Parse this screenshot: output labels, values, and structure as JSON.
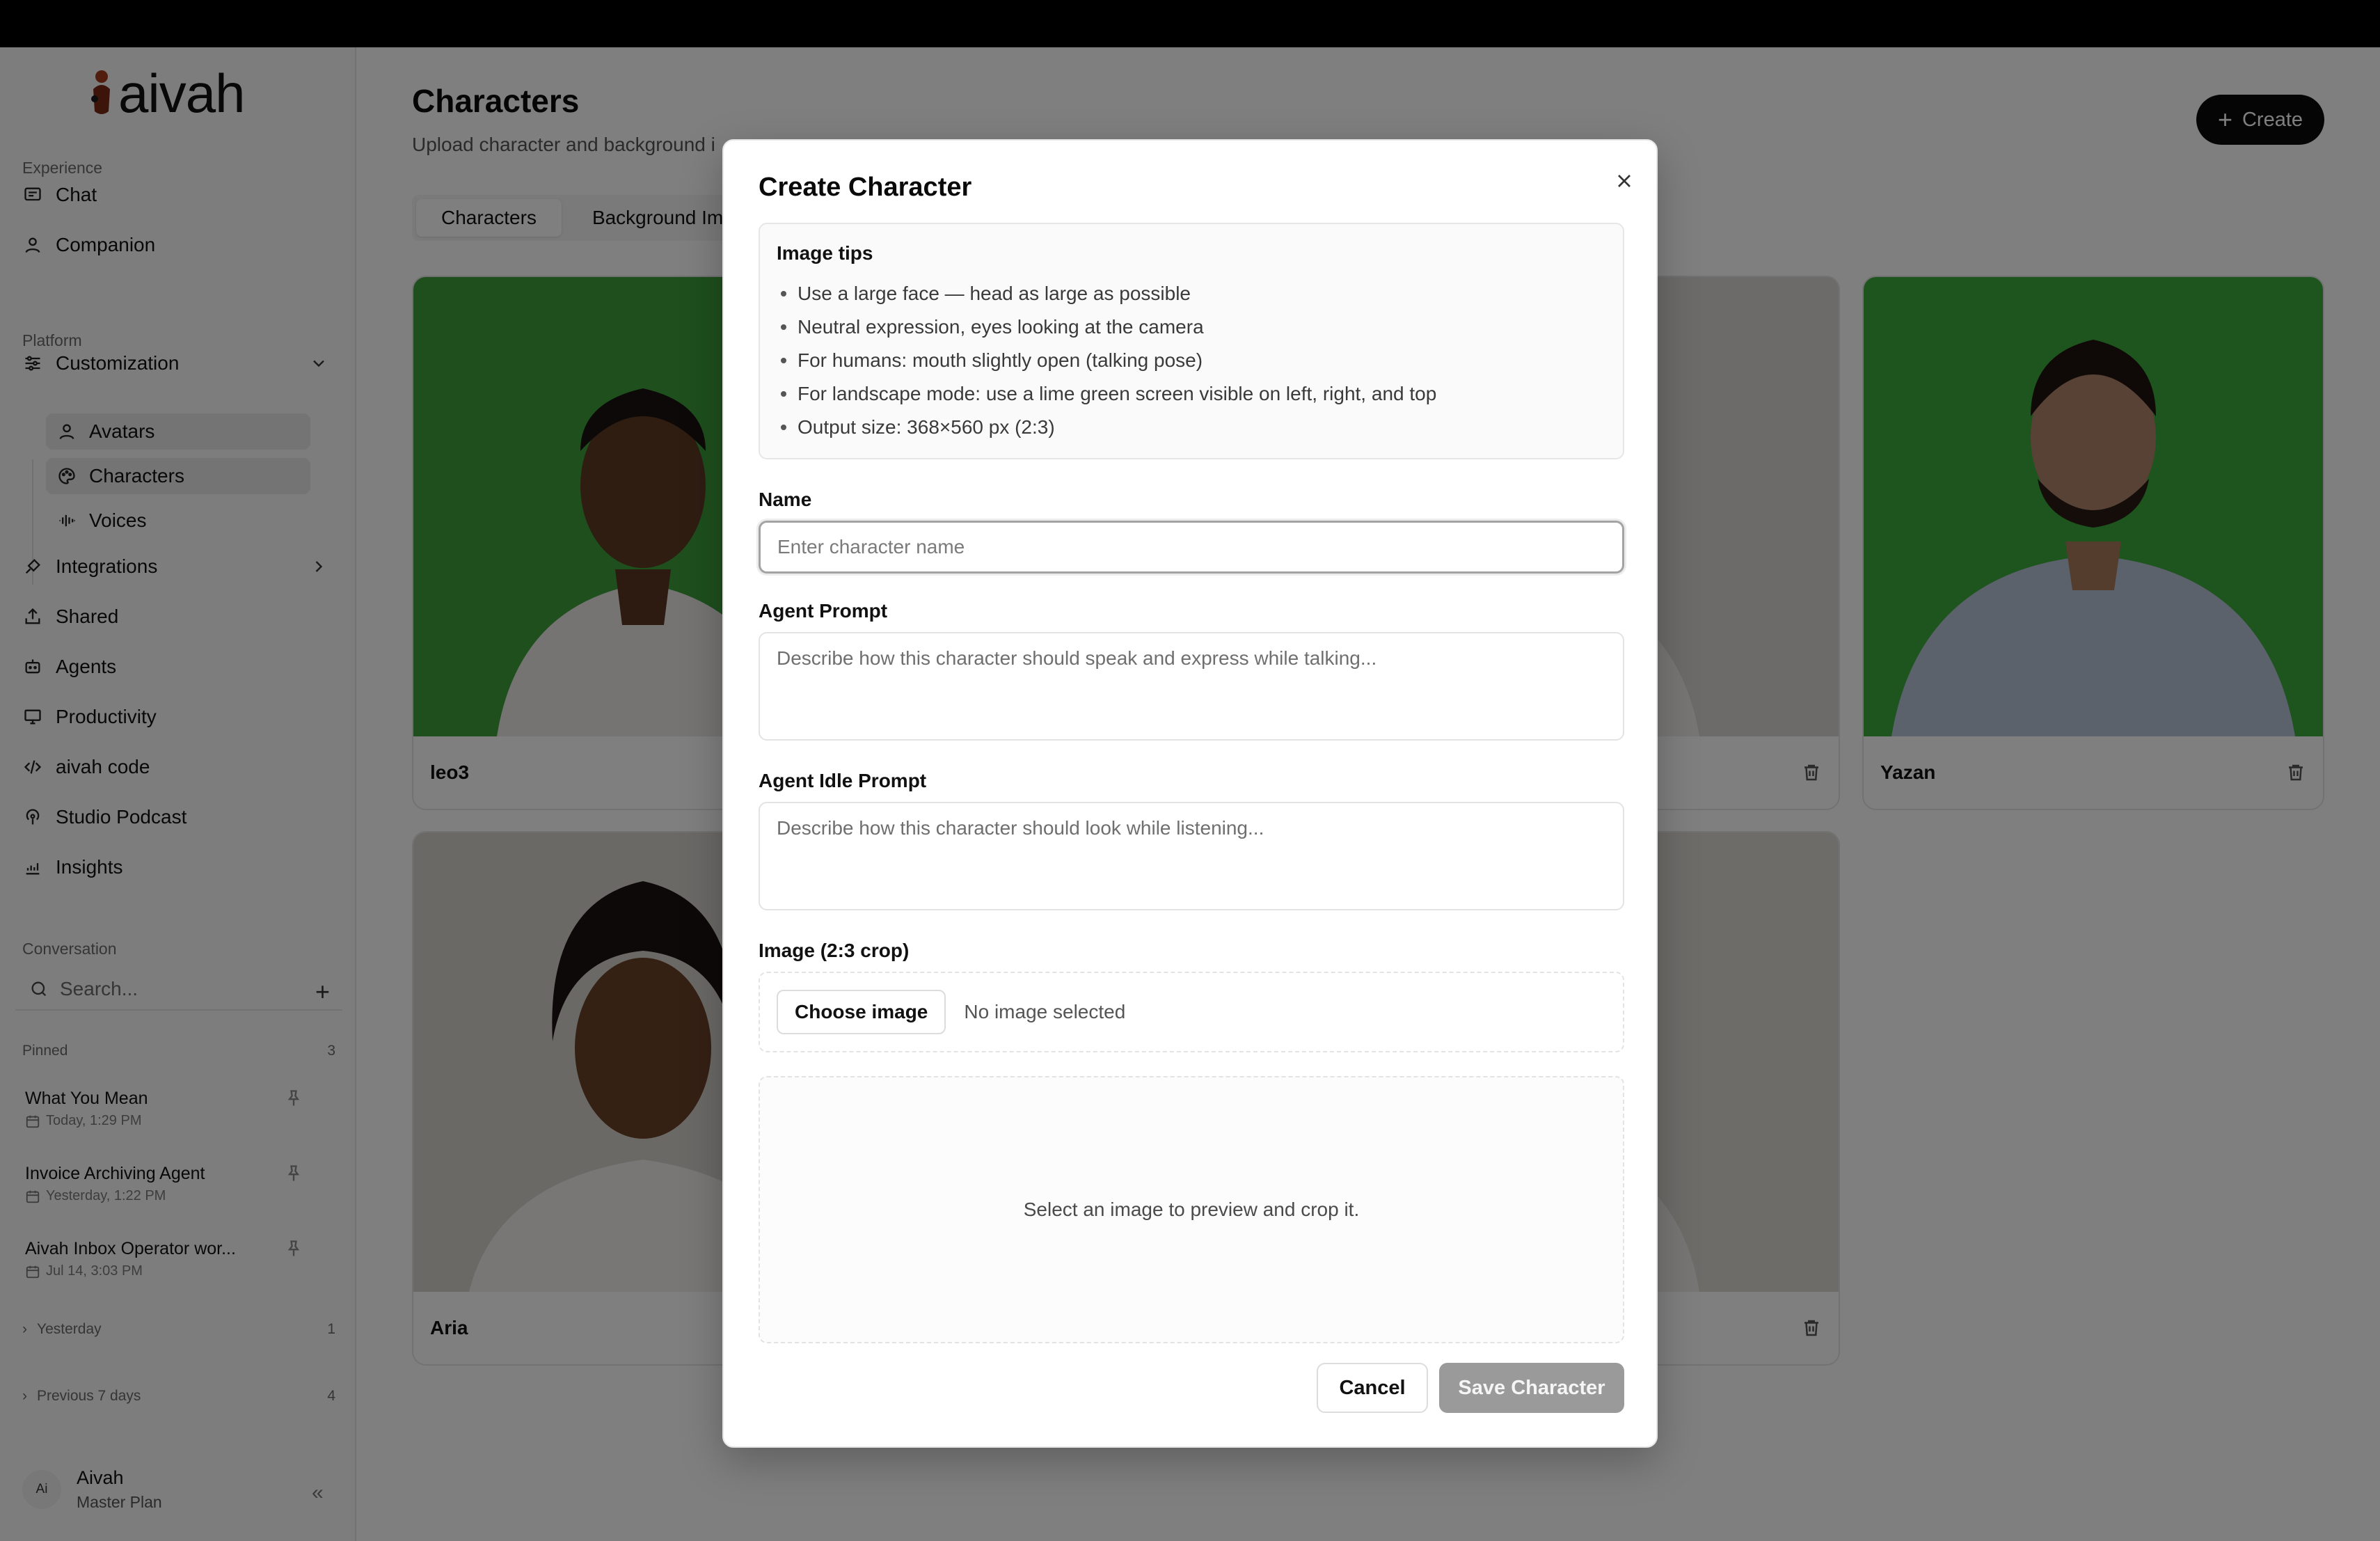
{
  "brand": {
    "name": "aivah"
  },
  "sidebar": {
    "sections": {
      "experience": "Experience",
      "platform": "Platform",
      "conversation": "Conversation"
    },
    "experience_items": [
      {
        "label": "Chat",
        "icon": "chat-icon"
      },
      {
        "label": "Companion",
        "icon": "user-icon"
      }
    ],
    "customization": {
      "label": "Customization",
      "icon": "sliders-icon"
    },
    "customization_items": [
      {
        "label": "Avatars",
        "icon": "avatar-icon",
        "active": true
      },
      {
        "label": "Characters",
        "icon": "palette-icon",
        "active": true
      },
      {
        "label": "Voices",
        "icon": "waveform-icon",
        "active": false
      }
    ],
    "platform_items": [
      {
        "label": "Integrations",
        "icon": "plug-icon"
      },
      {
        "label": "Shared",
        "icon": "share-icon"
      },
      {
        "label": "Agents",
        "icon": "bot-icon"
      },
      {
        "label": "Productivity",
        "icon": "monitor-icon"
      },
      {
        "label": "aivah code",
        "icon": "code-icon"
      },
      {
        "label": "Studio Podcast",
        "icon": "podcast-icon"
      },
      {
        "label": "Insights",
        "icon": "chart-icon"
      }
    ],
    "search": {
      "placeholder": "Search..."
    },
    "pinned": {
      "label": "Pinned",
      "count": "3"
    },
    "conversations": [
      {
        "title": "What You Mean",
        "date": "Today, 1:29 PM"
      },
      {
        "title": "Invoice Archiving Agent",
        "date": "Yesterday, 1:22 PM"
      },
      {
        "title": "Aivah Inbox Operator wor...",
        "date": "Jul 14, 3:03 PM"
      }
    ],
    "groups": [
      {
        "label": "Yesterday",
        "count": "1"
      },
      {
        "label": "Previous 7 days",
        "count": "4"
      }
    ],
    "user": {
      "initials": "Ai",
      "name": "Aivah",
      "plan": "Master Plan"
    }
  },
  "main": {
    "title": "Characters",
    "subtitle": "Upload character and background i",
    "create_label": "Create",
    "tabs": [
      {
        "label": "Characters",
        "active": true
      },
      {
        "label": "Background Im",
        "active": false
      }
    ],
    "cards": [
      {
        "name": "leo3",
        "bg": "#3c9e3a"
      },
      {
        "name": "",
        "bg": "#d9d6d2"
      },
      {
        "name": "Yazan",
        "bg": "#3ca83a"
      },
      {
        "name": "Aria",
        "bg": "#d6d2cd"
      },
      {
        "name": "",
        "bg": "#dcd8d3"
      }
    ]
  },
  "modal": {
    "title": "Create Character",
    "tips_title": "Image tips",
    "tips": [
      "Use a large face — head as large as possible",
      "Neutral expression, eyes looking at the camera",
      "For humans: mouth slightly open (talking pose)",
      "For landscape mode: use a lime green screen visible on left, right, and top",
      "Output size: 368×560 px (2:3)"
    ],
    "name_label": "Name",
    "name_placeholder": "Enter character name",
    "name_value": "",
    "prompt_label": "Agent Prompt",
    "prompt_placeholder": "Describe how this character should speak and express while talking...",
    "idle_label": "Agent Idle Prompt",
    "idle_placeholder": "Describe how this character should look while listening...",
    "image_label": "Image (2:3 crop)",
    "choose_label": "Choose image",
    "no_image": "No image selected",
    "preview_text": "Select an image to preview and crop it.",
    "cancel_label": "Cancel",
    "save_label": "Save Character"
  },
  "colors": {
    "accent": "#0a0a0a",
    "save_disabled": "#9a9a9a",
    "green_screen": "#3ca83a"
  }
}
